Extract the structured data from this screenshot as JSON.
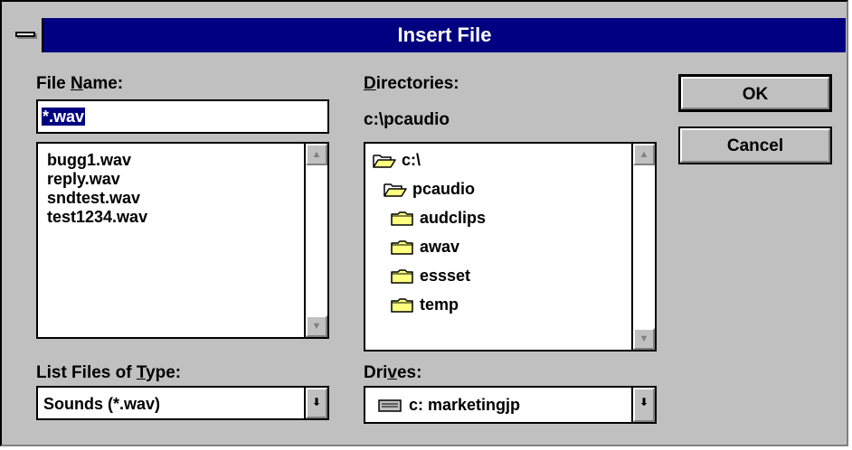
{
  "window": {
    "title": "Insert File"
  },
  "file_name": {
    "label_pre": "File ",
    "label_accel": "N",
    "label_post": "ame:",
    "value": "*.wav"
  },
  "files": [
    "bugg1.wav",
    "reply.wav",
    "sndtest.wav",
    "test1234.wav"
  ],
  "directories": {
    "label_accel": "D",
    "label_post": "irectories:",
    "current": "c:\\pcaudio",
    "items": [
      {
        "name": "c:\\",
        "icon": "open-folder-icon"
      },
      {
        "name": "pcaudio",
        "icon": "open-folder-icon"
      },
      {
        "name": "audclips",
        "icon": "folder-icon"
      },
      {
        "name": "awav",
        "icon": "folder-icon"
      },
      {
        "name": "essset",
        "icon": "folder-icon"
      },
      {
        "name": "temp",
        "icon": "folder-icon"
      }
    ]
  },
  "file_type": {
    "label_pre": "List Files of ",
    "label_accel": "T",
    "label_post": "ype:",
    "value": "Sounds (*.wav)"
  },
  "drives": {
    "label_pre": "Dri",
    "label_accel": "v",
    "label_post": "es:",
    "value": "c: marketingjp",
    "icon": "drive-icon"
  },
  "buttons": {
    "ok": "OK",
    "cancel": "Cancel"
  },
  "colors": {
    "titlebar": "#000080",
    "face": "#c0c0c0",
    "folder": "#ffff80"
  }
}
